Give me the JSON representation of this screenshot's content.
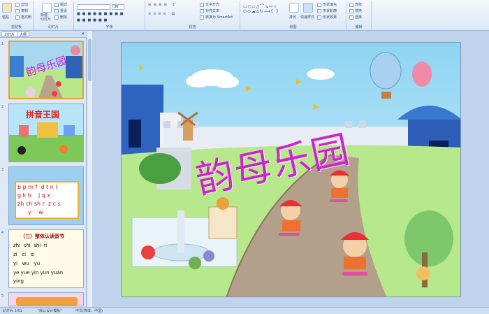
{
  "ribbon": {
    "clipboard": {
      "label": "剪贴板",
      "paste": "粘贴",
      "cut": "剪切",
      "copy": "复制",
      "format_painter": "格式刷"
    },
    "slides": {
      "label": "幻灯片",
      "new_slide": "新建\n幻灯片",
      "layout": "版式",
      "reset": "重设",
      "delete": "删除"
    },
    "font": {
      "label": "字体",
      "size": "36"
    },
    "paragraph": {
      "label": "段落",
      "text_direction": "文字方向",
      "align_text": "对齐文本",
      "smartart": "转换为 SmartArt"
    },
    "drawing": {
      "label": "绘图",
      "arrange": "排列",
      "quick_styles": "快速样式",
      "shape_fill": "形状填充",
      "shape_outline": "形状轮廓",
      "shape_effects": "形状效果"
    },
    "editing": {
      "label": "编辑",
      "find": "查找",
      "replace": "替换",
      "select": "选择"
    }
  },
  "left_pane": {
    "tabs": [
      "幻灯片",
      "大纲"
    ],
    "thumbnails": [
      {
        "num": "1",
        "title": "韵母乐园"
      },
      {
        "num": "2",
        "title": "拼音王国"
      },
      {
        "num": "3",
        "lines": [
          "b p m f  d t n l",
          "g k h    j q x",
          "zh ch sh r  z c s",
          "      y    w"
        ]
      },
      {
        "num": "4",
        "heading": "（三）整体认读音节",
        "lines": [
          "zhi  chi  shi  ri",
          "zi   ci   si",
          "yi   wu   yu",
          "ye yue yin yun yuan",
          "ying"
        ]
      },
      {
        "num": "5"
      }
    ]
  },
  "slide": {
    "title": "韵母乐园"
  },
  "status": {
    "slide_index": "幻灯片 1/51",
    "theme": "\"默认设计模板\"",
    "language": "中文(简体，中国)"
  },
  "colors": {
    "title": "#d020d0",
    "thumb_title": "#e02020",
    "pinyin": "#d01010",
    "ribbon_bg": "#dbe8f7",
    "selected_border": "#f0a030"
  }
}
